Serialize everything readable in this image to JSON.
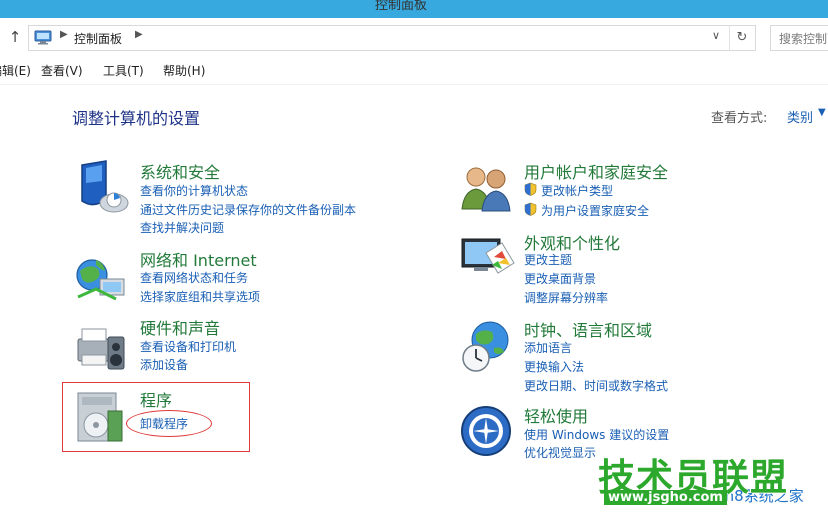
{
  "window": {
    "title": "控制面板"
  },
  "address_bar": {
    "crumb": "控制面板",
    "search_placeholder": "搜索控制面"
  },
  "menu": [
    "编辑(E)",
    "查看(V)",
    "工具(T)",
    "帮助(H)"
  ],
  "content": {
    "page_title": "调整计算机的设置",
    "view_label": "查看方式:",
    "view_value": "类别"
  },
  "categories": [
    {
      "icon": "system-security-icon",
      "title": "系统和安全",
      "links": [
        "查看你的计算机状态",
        "通过文件历史记录保存你的文件备份副本",
        "查找并解决问题"
      ]
    },
    {
      "icon": "network-internet-icon",
      "title": "网络和 Internet",
      "links": [
        "查看网络状态和任务",
        "选择家庭组和共享选项"
      ]
    },
    {
      "icon": "hardware-sound-icon",
      "title": "硬件和声音",
      "links": [
        "查看设备和打印机",
        "添加设备"
      ]
    },
    {
      "icon": "programs-icon",
      "title": "程序",
      "links": [
        "卸载程序"
      ]
    },
    {
      "icon": "user-accounts-icon",
      "title": "用户帐户和家庭安全",
      "links": [
        "更改帐户类型",
        "为用户设置家庭安全"
      ]
    },
    {
      "icon": "appearance-icon",
      "title": "外观和个性化",
      "links": [
        "更改主题",
        "更改桌面背景",
        "调整屏幕分辨率"
      ]
    },
    {
      "icon": "clock-region-icon",
      "title": "时钟、语言和区域",
      "links": [
        "添加语言",
        "更换输入法",
        "更改日期、时间或数字格式"
      ]
    },
    {
      "icon": "ease-of-access-icon",
      "title": "轻松使用",
      "links": [
        "使用 Windows 建议的设置",
        "优化视觉显示"
      ]
    }
  ],
  "watermark": {
    "main": "技术员联盟",
    "url": "www.jsgho.com",
    "overlap": "Win8系统之家"
  },
  "colors": {
    "titlebar": "#37a9de",
    "category_heading": "#227a3a",
    "link": "#1a5fb4",
    "annotation": "#e03a3a",
    "watermark": "#2ca82c"
  }
}
